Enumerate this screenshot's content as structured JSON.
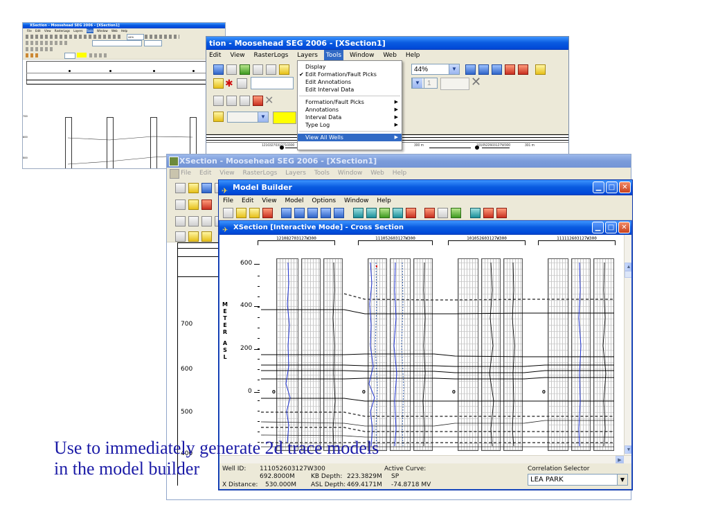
{
  "thumb": {
    "title": "XSection - Moosehead SEG 2006 - [XSection1]",
    "menu": [
      "File",
      "Edit",
      "View",
      "RasterLogs",
      "Layers",
      "Tools",
      "Window",
      "Web",
      "Help"
    ],
    "zoom": "44%",
    "axis_labels": [
      "700",
      "600",
      "500"
    ]
  },
  "back_window": {
    "title": "tion - Moosehead SEG 2006 - [XSection1]",
    "menu": [
      "Edit",
      "View",
      "RasterLogs",
      "Layers",
      "Tools",
      "Window",
      "Web",
      "Help"
    ],
    "zoom": "44%",
    "page_value": "1",
    "ruler_labels": [
      "12103270312710300",
      "300 m",
      "1010522603127W300",
      "301 m"
    ],
    "tools_menu": {
      "items": [
        {
          "label": "Display",
          "checked": false,
          "submenu": false
        },
        {
          "label": "Edit Formation/Fault Picks",
          "checked": true,
          "submenu": false
        },
        {
          "label": "Edit Annotations",
          "checked": false,
          "submenu": false
        },
        {
          "label": "Edit Interval Data",
          "checked": false,
          "submenu": false
        },
        {
          "label": "Formation/Fault Picks",
          "checked": false,
          "submenu": true
        },
        {
          "label": "Annotations",
          "checked": false,
          "submenu": true
        },
        {
          "label": "Interval Data",
          "checked": false,
          "submenu": true
        },
        {
          "label": "Type Log",
          "checked": false,
          "submenu": true
        },
        {
          "label": "View All Wells",
          "checked": false,
          "submenu": true
        }
      ]
    }
  },
  "mid_window": {
    "title": "XSection - Moosehead SEG 2006 - [XSection1]",
    "menu": [
      "File",
      "Edit",
      "View",
      "RasterLogs",
      "Layers",
      "Tools",
      "Window",
      "Web",
      "Help"
    ],
    "axis_labels": [
      "700",
      "600",
      "500",
      "400"
    ]
  },
  "model_builder": {
    "title": "Model Builder",
    "menu": [
      "File",
      "Edit",
      "View",
      "Model",
      "Options",
      "Window",
      "Help"
    ]
  },
  "xsection": {
    "title": "XSection [Interactive Mode] - Cross Section",
    "axis_title_letters": [
      "M",
      "E",
      "T",
      "E",
      "R",
      "",
      "A",
      "S",
      "L"
    ],
    "y_ticks": [
      "600",
      "400",
      "200",
      "0"
    ],
    "wells": [
      {
        "label": "121082703127W300",
        "zero": "0"
      },
      {
        "label": "111052603127W300",
        "zero": "0"
      },
      {
        "label": "101052603127W300",
        "zero": "0"
      },
      {
        "label": "111112603127W300",
        "zero": "0"
      }
    ],
    "status": {
      "well_id_label": "Well ID:",
      "well_id": "111052603127W300",
      "row2_value": "692.8000M",
      "kb_label": "KB Depth:",
      "kb_value": "223.3829M",
      "x_label": "X Distance:",
      "x_value": "530.000M",
      "asl_label": "ASL Depth:",
      "asl_value": "469.4171M",
      "active_curve_label": "Active Curve:",
      "active_curve": "SP",
      "curve_value": "-74.8718 MV",
      "correlation_label": "Correlation Selector",
      "correlation_value": "LEA PARK"
    }
  },
  "caption": {
    "line1": "Use to immediately generate 2d trace models",
    "line2": "in the model builder"
  },
  "colors": {
    "title_active": "#0a5be0",
    "title_inactive": "#7b9cda",
    "chrome": "#ece9d8",
    "caption_text": "#1a1aa6",
    "log_curve": "#1b2fd0"
  }
}
